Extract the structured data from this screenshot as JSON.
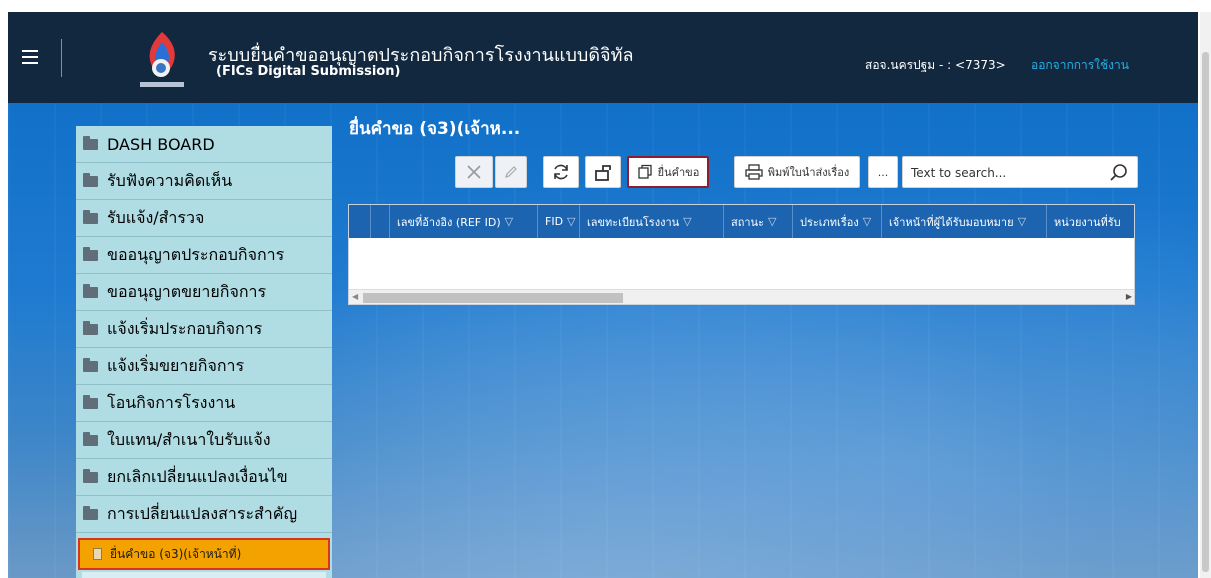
{
  "header": {
    "title": "ระบบยื่นคำขออนุญาตประกอบกิจการโรงงานแบบดิจิทัล",
    "subtitle": "(FICs Digital Submission)",
    "user": "สอจ.นครปฐม - : <7373>",
    "logout": "ออกจากการใช้งาน"
  },
  "sidebar": {
    "items": [
      {
        "label": "DASH BOARD"
      },
      {
        "label": "รับฟังความคิดเห็น"
      },
      {
        "label": "รับแจ้ง/สำรวจ"
      },
      {
        "label": "ขออนุญาตประกอบกิจการ"
      },
      {
        "label": "ขออนุญาตขยายกิจการ"
      },
      {
        "label": "แจ้งเริ่มประกอบกิจการ"
      },
      {
        "label": "แจ้งเริ่มขยายกิจการ"
      },
      {
        "label": "โอนกิจการโรงงาน"
      },
      {
        "label": "ใบแทน/สำเนาใบรับแจ้ง"
      },
      {
        "label": "ยกเลิกเปลี่ยนแปลงเงื่อนไข"
      },
      {
        "label": "การเปลี่ยนแปลงสาระสำคัญ"
      }
    ],
    "active_sub": "ยื่นคำขอ (จ3)(เจ้าหน้าที่)"
  },
  "main": {
    "title": "ยื่นคำขอ (จ3)(เจ้าห...",
    "toolbar": {
      "submit_label": "ยื่นคำขอ",
      "print_label": "พิมพ์ใบนำส่งเรื่อง",
      "more_label": "...",
      "search_placeholder": "Text to search..."
    },
    "grid": {
      "columns": [
        "เลขที่อ้างอิง (REF ID)",
        "FID",
        "เลขทะเบียนโรงงาน",
        "สถานะ",
        "ประเภทเรื่อง",
        "เจ้าหน้าที่ผู้ได้รับมอบหมาย",
        "หน่วยงานที่รับ"
      ]
    }
  },
  "colors": {
    "header_bg": "#12283f",
    "sidebar_bg": "#b0dce4",
    "grid_header_bg": "#1c63b0",
    "active_item_bg": "#f4a200",
    "highlight_border": "#d6361f",
    "logout_link": "#28b0e8"
  },
  "icons": [
    "hamburger-icon",
    "logo-icon",
    "folder-icon",
    "document-icon",
    "close-icon",
    "edit-icon",
    "refresh-icon",
    "export-icon",
    "copy-icon",
    "printer-icon",
    "more-icon",
    "search-icon",
    "filter-icon"
  ]
}
